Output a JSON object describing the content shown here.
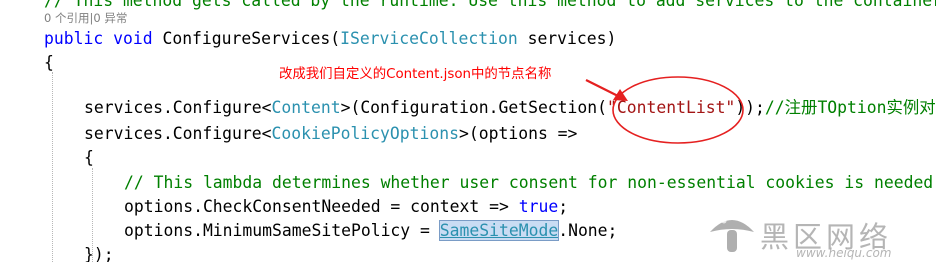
{
  "code": {
    "comment_top": "// This method gets called by the runtime. Use this method to add services to the container.",
    "codelens": "0 个引用|0 异常",
    "line_signature": {
      "kw_public": "public",
      "kw_void": "void",
      "method": "ConfigureServices(",
      "param_type": "IServiceCollection",
      "param_rest": " services)"
    },
    "open_brace": "{",
    "line_configure_content": {
      "prefix": "services.Configure<",
      "type": "Content",
      "mid": ">(Configuration.GetSection(",
      "string": "\"ContentList\"",
      "after": "));",
      "comment": "//注册TOption实例对象"
    },
    "line_configure_cookie": {
      "prefix": "services.Configure<",
      "type": "CookiePolicyOptions",
      "after": ">(options =>"
    },
    "inner_open_brace": "{",
    "lambda_comment": "// This lambda determines whether user consent for non-essential cookies is needed for a given request.",
    "line_consent": {
      "prefix": "options.CheckConsentNeeded = context => ",
      "kw_true": "true",
      "after": ";"
    },
    "line_samesite": {
      "prefix": "options.MinimumSameSitePolicy = ",
      "type": "SameSiteMode",
      "after": ".None;"
    },
    "close_lambda": "});"
  },
  "annotation": {
    "text": "改成我们自定义的Content.json中的节点名称",
    "color": "#ff0000"
  },
  "watermark": {
    "text": "黑区网络",
    "url": "www.heiqu.com"
  },
  "colors": {
    "keyword": "#0000ff",
    "type": "#2b91af",
    "comment": "#008000",
    "string": "#a31515",
    "annotation": "#ff0000"
  }
}
